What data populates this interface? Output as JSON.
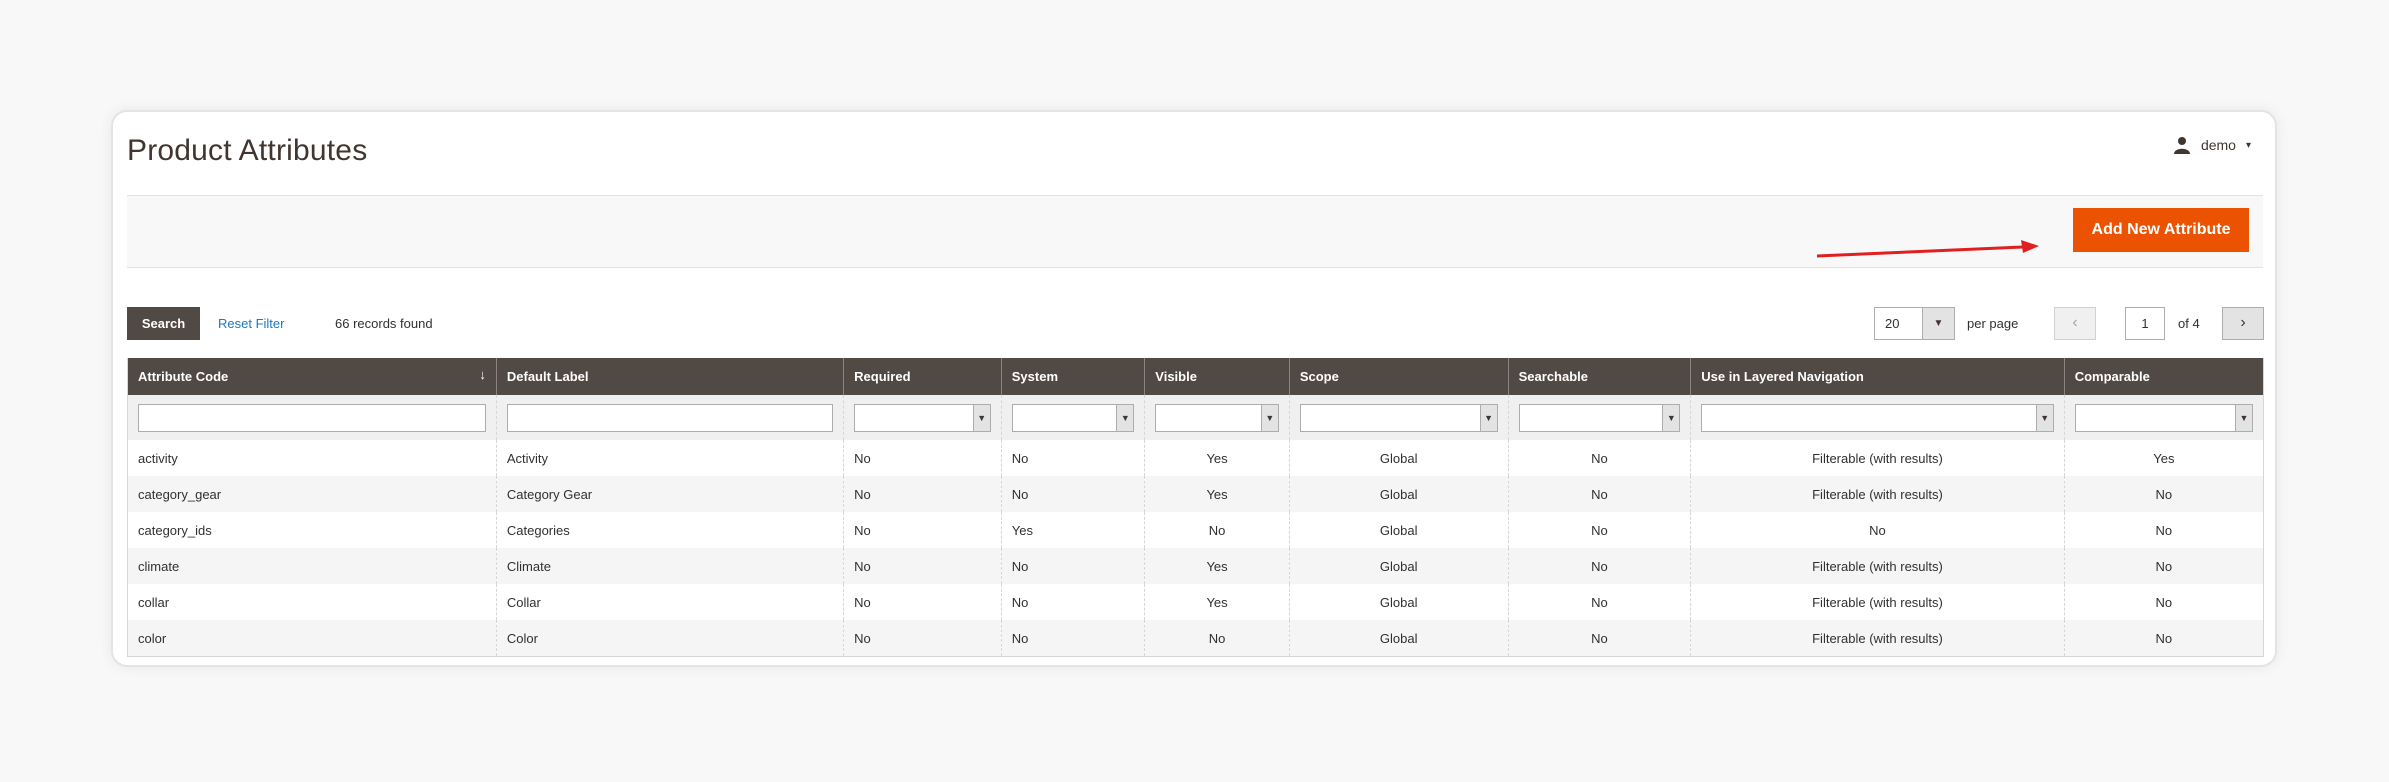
{
  "header": {
    "title": "Product Attributes",
    "user_name": "demo",
    "user_icon": "user-icon",
    "user_caret": "▾"
  },
  "actions": {
    "add_new_label": "Add New Attribute",
    "add_button_color": "#eb5202"
  },
  "toolbar": {
    "search_label": "Search",
    "reset_label": "Reset Filter",
    "records_text": "66 records found",
    "per_page_value": "20",
    "per_page_label": "per page",
    "current_page": "1",
    "of_pages": "of 4"
  },
  "grid": {
    "header_color": "#514943",
    "columns": [
      "Attribute Code",
      "Default Label",
      "Required",
      "System",
      "Visible",
      "Scope",
      "Searchable",
      "Use in Layered Navigation",
      "Comparable"
    ],
    "sort_indicator": "↓",
    "rows": [
      [
        "activity",
        "Activity",
        "No",
        "No",
        "Yes",
        "Global",
        "No",
        "Filterable (with results)",
        "Yes"
      ],
      [
        "category_gear",
        "Category Gear",
        "No",
        "No",
        "Yes",
        "Global",
        "No",
        "Filterable (with results)",
        "No"
      ],
      [
        "category_ids",
        "Categories",
        "No",
        "Yes",
        "No",
        "Global",
        "No",
        "No",
        "No"
      ],
      [
        "climate",
        "Climate",
        "No",
        "No",
        "Yes",
        "Global",
        "No",
        "Filterable (with results)",
        "No"
      ],
      [
        "collar",
        "Collar",
        "No",
        "No",
        "Yes",
        "Global",
        "No",
        "Filterable (with results)",
        "No"
      ],
      [
        "color",
        "Color",
        "No",
        "No",
        "No",
        "Global",
        "No",
        "Filterable (with results)",
        "No"
      ]
    ]
  }
}
